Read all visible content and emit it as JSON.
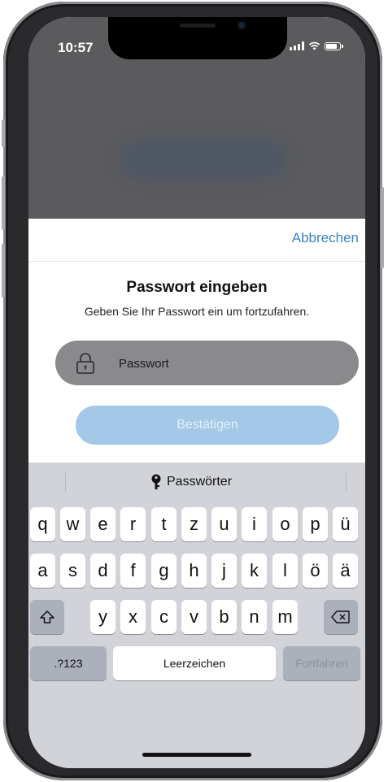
{
  "status_bar": {
    "time": "10:57"
  },
  "sheet": {
    "cancel_label": "Abbrechen",
    "title": "Passwort eingeben",
    "subtitle": "Geben Sie Ihr Passwort ein um fortzufahren.",
    "password_placeholder": "Passwort",
    "confirm_label": "Bestätigen"
  },
  "keyboard": {
    "suggestion_label": "Passwörter",
    "row1": [
      "q",
      "w",
      "e",
      "r",
      "t",
      "z",
      "u",
      "i",
      "o",
      "p",
      "ü"
    ],
    "row2": [
      "a",
      "s",
      "d",
      "f",
      "g",
      "h",
      "j",
      "k",
      "l",
      "ö",
      "ä"
    ],
    "row3": [
      "y",
      "x",
      "c",
      "v",
      "b",
      "n",
      "m"
    ],
    "numbers_label": ".?123",
    "space_label": "Leerzeichen",
    "return_label": "Fortfahren"
  },
  "colors": {
    "accent": "#3b82c4",
    "confirm_disabled": "#a3c8e8",
    "keyboard_bg": "#d1d3d9"
  }
}
